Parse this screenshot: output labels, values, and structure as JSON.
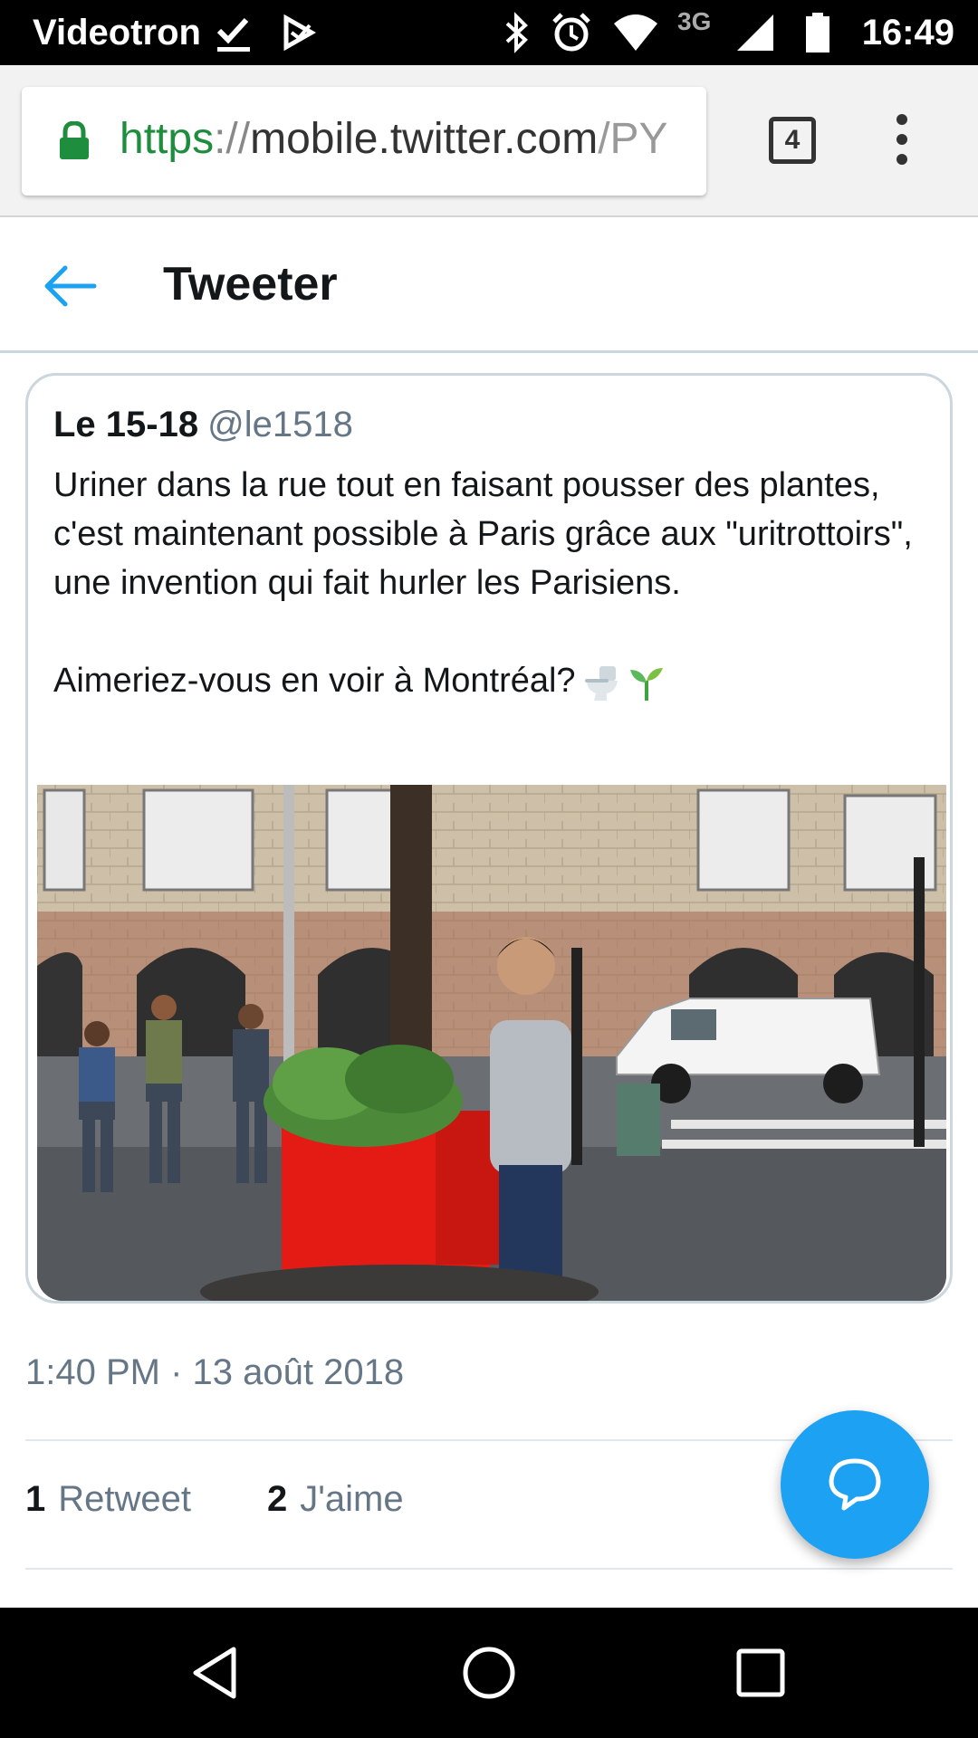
{
  "status_bar": {
    "carrier": "Videotron",
    "network": "3G",
    "time": "16:49",
    "icons": [
      "check-icon",
      "play-store-icon",
      "bluetooth-icon",
      "alarm-icon",
      "wifi-icon",
      "signal-icon",
      "battery-icon"
    ]
  },
  "browser": {
    "url_scheme": "https",
    "url_separator": "://",
    "url_host": "mobile.twitter.com",
    "url_rest": "/PY",
    "tab_count": "4"
  },
  "header": {
    "title": "Tweeter"
  },
  "quoted_tweet": {
    "name": "Le 15-18",
    "handle": "@le1518",
    "text": "Uriner dans la rue tout en faisant pousser des plantes, c'est maintenant possible à Paris grâce aux \"uritrottoirs\", une invention qui fait hurler les Parisiens.\n\nAimeriez-vous en voir à Montréal?",
    "emojis": [
      "toilet-emoji",
      "seedling-emoji"
    ]
  },
  "tweet": {
    "timestamp": "1:40 PM · 13 août 2018",
    "retweet_count": "1",
    "retweet_label": "Retweet",
    "like_count": "2",
    "like_label": "J'aime"
  },
  "colors": {
    "accent": "#1da1f2",
    "secondary_text": "#657786",
    "url_green": "#1e8e3e"
  }
}
